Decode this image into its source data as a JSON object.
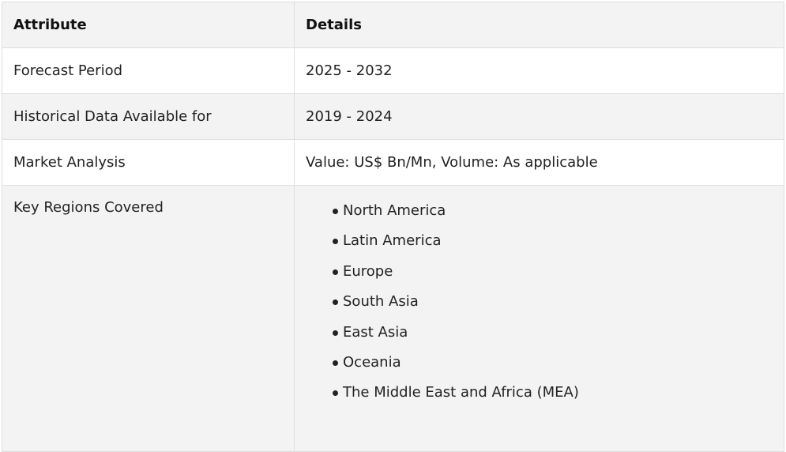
{
  "table": {
    "headers": [
      "Attribute",
      "Details"
    ],
    "rows": [
      {
        "attribute": "Forecast Period",
        "details": "2025 - 2032"
      },
      {
        "attribute": "Historical Data Available for",
        "details": "2019 - 2024"
      },
      {
        "attribute": "Market Analysis",
        "details": "Value: US$ Bn/Mn, Volume: As applicable"
      },
      {
        "attribute": "Key Regions Covered",
        "details_list": [
          "North America",
          "Latin America",
          "Europe",
          "South Asia",
          "East Asia",
          "Oceania",
          "The Middle East and Africa (MEA)"
        ]
      }
    ]
  }
}
